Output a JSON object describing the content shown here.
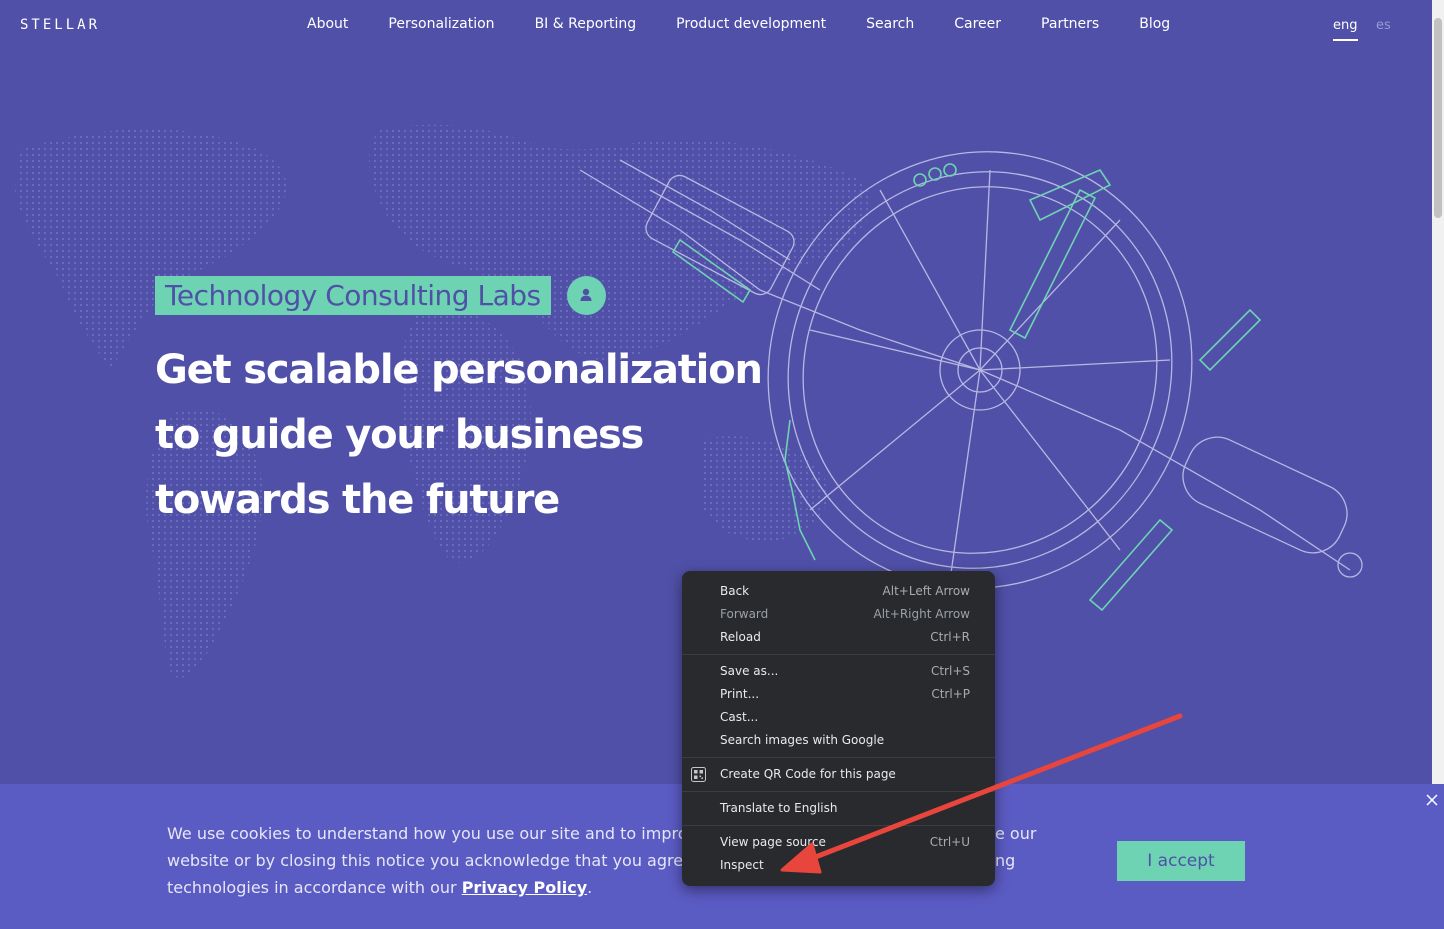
{
  "header": {
    "logo": "STELLAR",
    "nav": [
      {
        "label": "About"
      },
      {
        "label": "Personalization"
      },
      {
        "label": "BI & Reporting"
      },
      {
        "label": "Product development"
      },
      {
        "label": "Search"
      },
      {
        "label": "Career"
      },
      {
        "label": "Partners"
      },
      {
        "label": "Blog"
      }
    ],
    "languages": {
      "active": "eng",
      "other": "es"
    }
  },
  "hero": {
    "tag": "Technology Consulting Labs",
    "headline": [
      "Get scalable personalization",
      "to guide your business",
      "towards the future"
    ]
  },
  "cookie_banner": {
    "lines": [
      "We use cookies to understand how you use our site and to impro",
      "website or by closing this notice you acknowledge that you agree",
      "technologies in accordance with our "
    ],
    "line_tail_1": "e our",
    "line_tail_2": "ng",
    "policy_link": "Privacy Policy",
    "policy_suffix": ".",
    "accept_label": "I accept"
  },
  "context_menu": {
    "groups": [
      [
        {
          "label": "Back",
          "shortcut": "Alt+Left Arrow",
          "enabled": true
        },
        {
          "label": "Forward",
          "shortcut": "Alt+Right Arrow",
          "enabled": false
        },
        {
          "label": "Reload",
          "shortcut": "Ctrl+R",
          "enabled": true
        }
      ],
      [
        {
          "label": "Save as...",
          "shortcut": "Ctrl+S",
          "enabled": true
        },
        {
          "label": "Print...",
          "shortcut": "Ctrl+P",
          "enabled": true
        },
        {
          "label": "Cast...",
          "shortcut": "",
          "enabled": true
        },
        {
          "label": "Search images with Google",
          "shortcut": "",
          "enabled": true
        }
      ],
      [
        {
          "label": "Create QR Code for this page",
          "shortcut": "",
          "enabled": true,
          "icon": "qr-code-icon"
        }
      ],
      [
        {
          "label": "Translate to English",
          "shortcut": "",
          "enabled": true
        }
      ],
      [
        {
          "label": "View page source",
          "shortcut": "Ctrl+U",
          "enabled": true
        },
        {
          "label": "Inspect",
          "shortcut": "",
          "enabled": true
        }
      ]
    ]
  },
  "colors": {
    "background": "#5050a8",
    "accent": "#6ed3b3",
    "banner": "#5b5bc4",
    "menu": "#292a2d",
    "arrow": "#e8453c"
  }
}
